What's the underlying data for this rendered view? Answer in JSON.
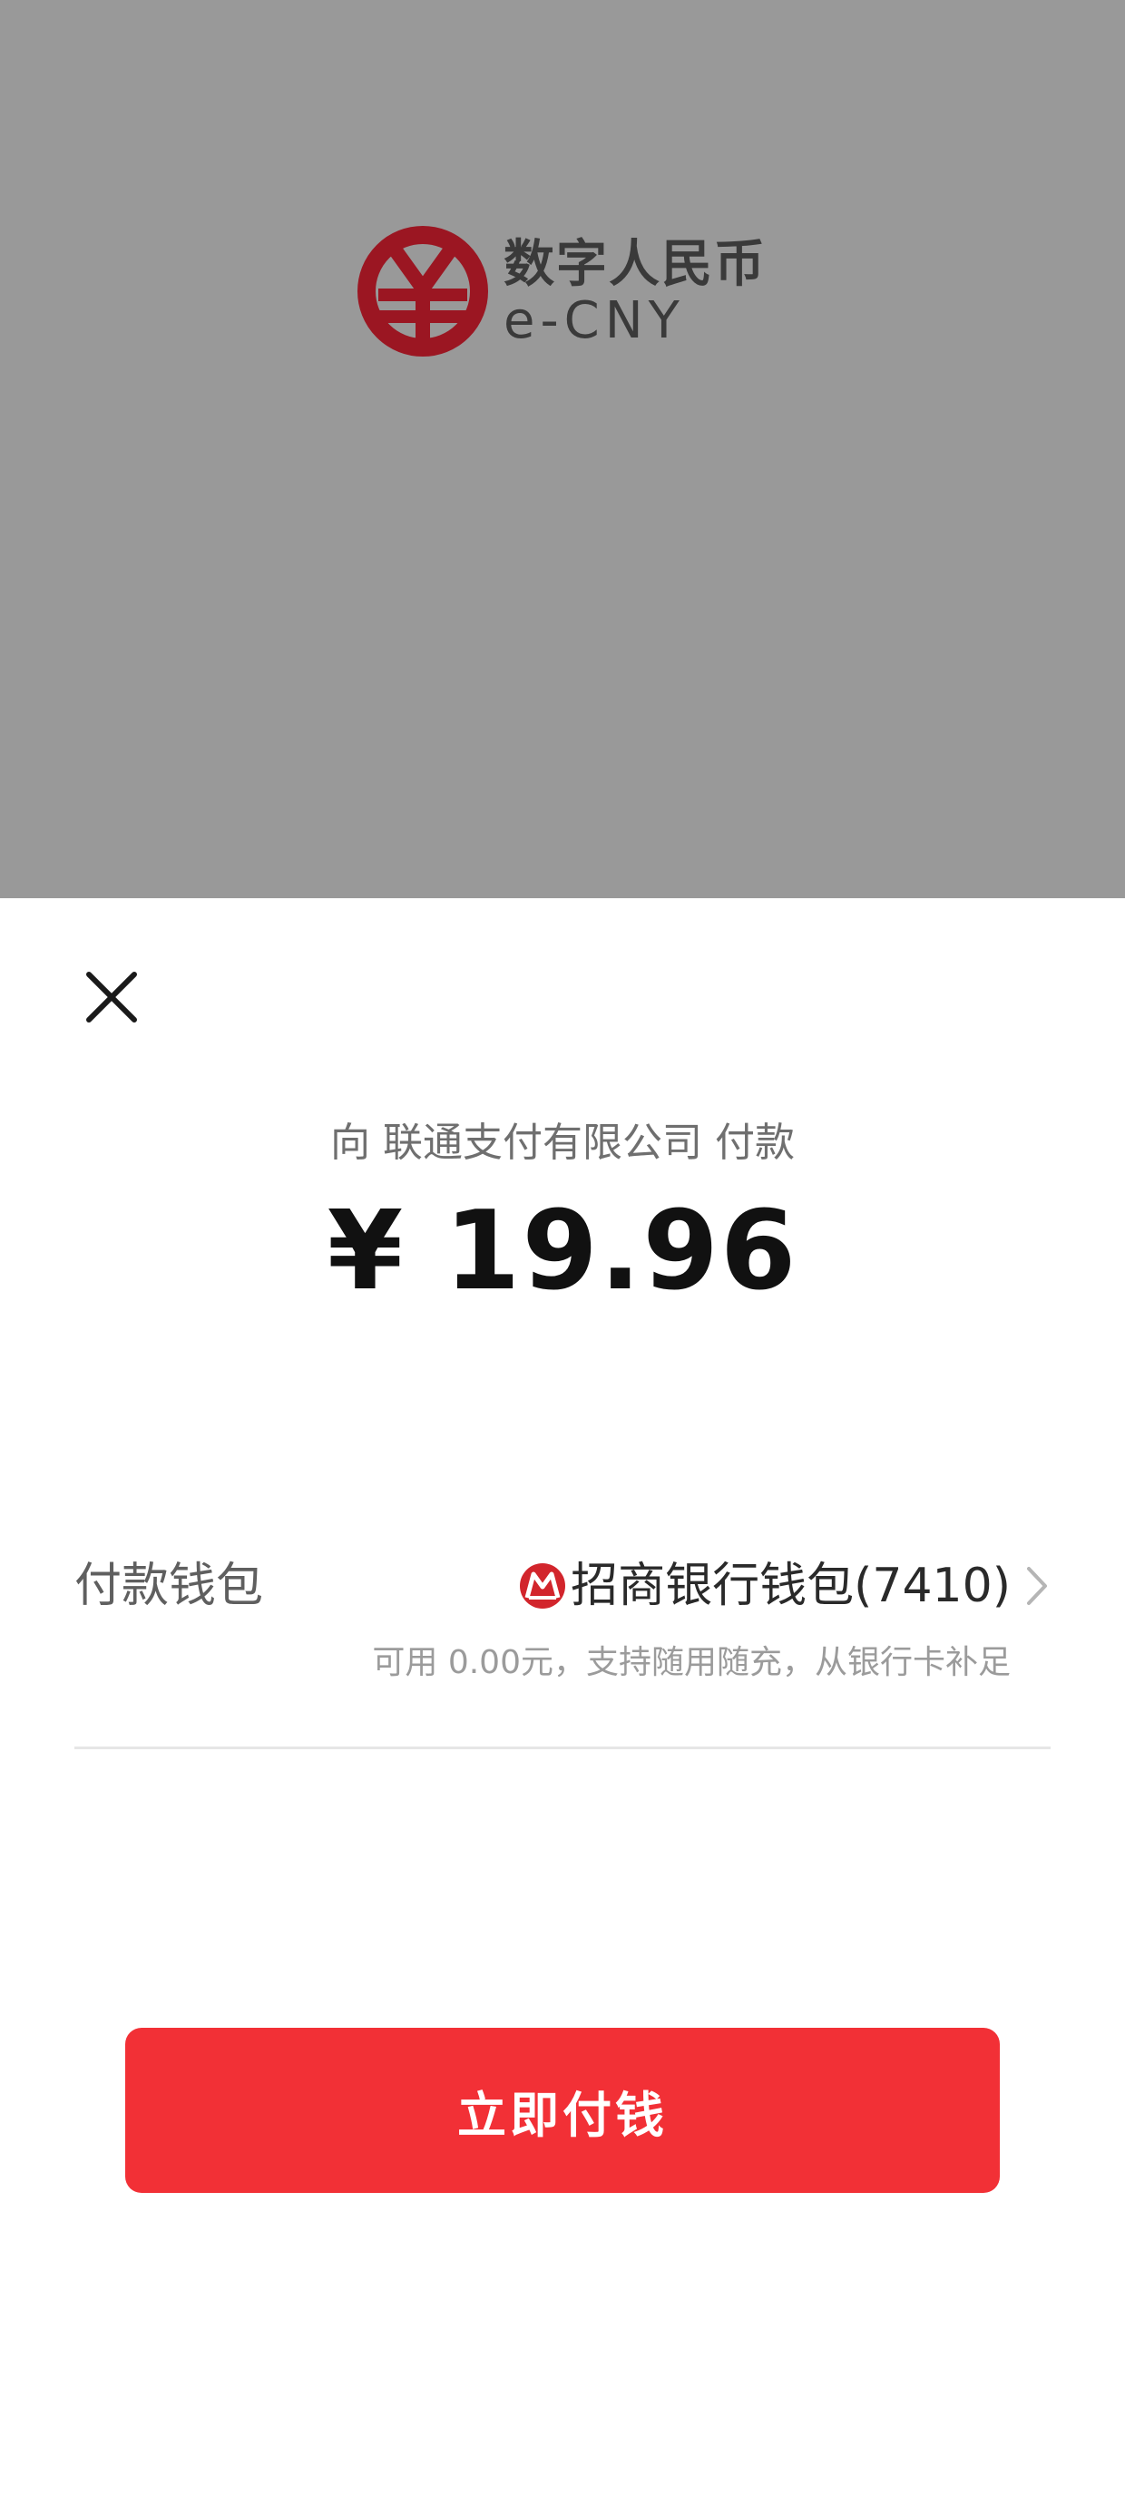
{
  "brand": {
    "name_cn": "数字人民币",
    "name_en": "e-CNY",
    "accent_color": "#9b1622",
    "icon": "e-cny-yuan-logo-icon"
  },
  "payment": {
    "payee_text": "向 联通支付有限公司 付款",
    "amount": "¥ 19.96"
  },
  "wallet": {
    "label": "付款钱包",
    "selected": "招商银行钱包(7410)",
    "bank_icon": "cmb-bank-logo-icon",
    "hint": "可用 0.00元，支持随用随充，从银行卡补足"
  },
  "actions": {
    "close_icon": "close-icon",
    "pay_label": "立即付钱",
    "pay_color": "#f23036"
  }
}
